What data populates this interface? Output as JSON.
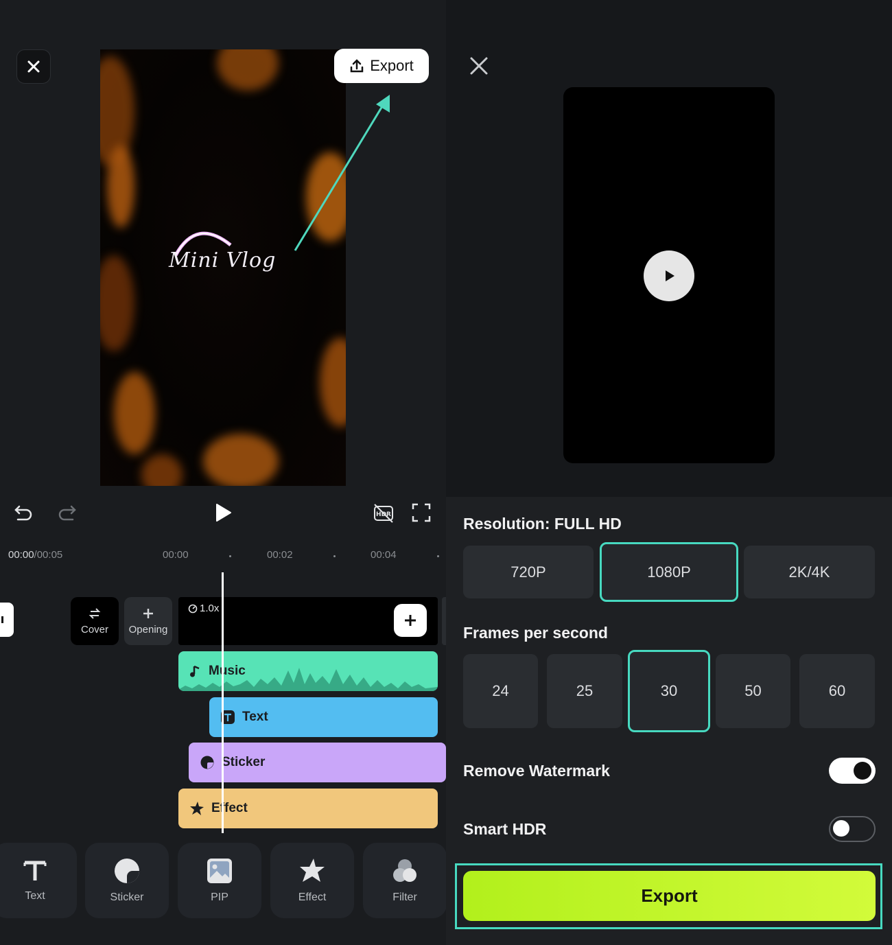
{
  "editor": {
    "export_label": "Export",
    "preview_text": "Mini Vlog",
    "time": {
      "current": "00:00",
      "total": "/00:05"
    },
    "ruler": [
      "00:00",
      "00:02",
      "00:04"
    ],
    "speed": "1.0x",
    "cover_label": "Cover",
    "opening_label": "Opening",
    "lanes": {
      "music": "Music",
      "text": "Text",
      "sticker": "Sticker",
      "effect": "Effect"
    },
    "tools": [
      "Text",
      "Sticker",
      "PIP",
      "Effect",
      "Filter"
    ]
  },
  "export_settings": {
    "resolution_title": "Resolution: FULL HD",
    "resolutions": [
      "720P",
      "1080P",
      "2K/4K"
    ],
    "selected_resolution": "1080P",
    "fps_title": "Frames per second",
    "fps_options": [
      "24",
      "25",
      "30",
      "50",
      "60"
    ],
    "selected_fps": "30",
    "remove_watermark_label": "Remove Watermark",
    "remove_watermark_on": true,
    "smart_hdr_label": "Smart HDR",
    "smart_hdr_on": false,
    "export_button": "Export"
  },
  "colors": {
    "accent_teal": "#47d9c0",
    "export_green": "#c4f62a",
    "music": "#57e3b6",
    "text": "#53bdf1",
    "sticker": "#c9a6f9",
    "effect": "#f1c77c"
  }
}
